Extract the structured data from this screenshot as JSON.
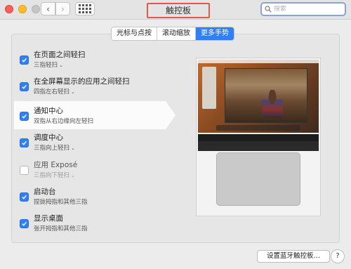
{
  "window": {
    "title": "触控板",
    "search_placeholder": "搜索",
    "back_glyph": "‹",
    "forward_glyph": "›"
  },
  "tabs": [
    {
      "label": "光标与点按",
      "active": false
    },
    {
      "label": "滚动缩放",
      "active": false
    },
    {
      "label": "更多手势",
      "active": true
    }
  ],
  "options": [
    {
      "title": "在页面之间轻扫",
      "sub": "三指轻扫",
      "checked": true,
      "dropdown": true
    },
    {
      "title": "在全屏幕显示的应用之间轻扫",
      "sub": "四指左右轻扫",
      "checked": true,
      "dropdown": true
    },
    {
      "title": "通知中心",
      "sub": "双指从右边缘向左轻扫",
      "checked": true,
      "dropdown": false
    },
    {
      "title": "调度中心",
      "sub": "三指向上轻扫",
      "checked": true,
      "dropdown": true
    },
    {
      "title": "应用 Exposé",
      "sub": "三指向下轻扫",
      "checked": false,
      "dropdown": true
    },
    {
      "title": "启动台",
      "sub": "捏拢拇指和其他三指",
      "checked": true,
      "dropdown": false
    },
    {
      "title": "显示桌面",
      "sub": "张开拇指和其他三指",
      "checked": true,
      "dropdown": false
    }
  ],
  "footer": {
    "bluetooth_button": "设置蓝牙触控板…",
    "help_button": "?"
  },
  "colors": {
    "accent": "#2f7ff6",
    "title_highlight_border": "#e45a48"
  }
}
